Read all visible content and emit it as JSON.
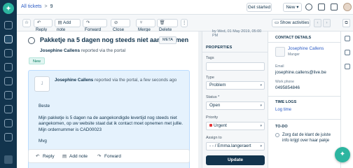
{
  "breadcrumb": {
    "link": "All tickets",
    "separator": ">",
    "ticket_id": "9"
  },
  "header": {
    "get_started": "Get started",
    "new_label": "New",
    "new_chevron": "▾"
  },
  "toolbar": {
    "star": "☆",
    "reply": "Reply",
    "add_note": "Add note",
    "forward": "Forward",
    "close": "Close",
    "merge": "Merge",
    "delete": "Delete",
    "more": "⋮",
    "show_activities": "Show activities",
    "prev": "‹",
    "next": "›",
    "expand": "⧉"
  },
  "ticket": {
    "subject": "Pakketje na 5 dagen nog steeds niet aangekomen",
    "meta_tag": "META",
    "reporter_name": "Josephine Callens",
    "reporter_text": "reported via the portal",
    "status_badge": "New"
  },
  "conversation": {
    "avatar_letter": "J",
    "author": "Josephine Callens",
    "header_text": "reported via the portal, a few seconds ago",
    "greeting": "Beste",
    "body": "Mijn pakketje is 5 dagen na de aangekondigde levertijd nog steeds niet aangekomen, op uw website staat dat ik contact moet opnemen met jullie.",
    "order": "Mijn ordernummer is CAD00023",
    "signoff": "Mvg"
  },
  "reply_bar": {
    "reply": "Reply",
    "add_note": "Add note",
    "forward": "Forward"
  },
  "properties": {
    "date": "by Wed, 01 May 2019, 05:00 PM",
    "heading": "PROPERTIES",
    "tags_label": "Tags",
    "type_label": "Type",
    "type_value": "Problem",
    "status_label": "Status *",
    "status_value": "Open",
    "priority_label": "Priority",
    "priority_value": "Urgent",
    "priority_color": "#e43538",
    "assign_label": "Assign to",
    "assign_value": "- - / Emma.langeraert",
    "update_button": "Update"
  },
  "contact": {
    "heading": "CONTACT DETAILS",
    "name": "Josephine Callens",
    "role": "Manger",
    "email_label": "Email",
    "email": "josephine.callens@live.be",
    "phone_label": "Work phone",
    "phone": "0495854846",
    "time_logs_heading": "TIME LOGS",
    "log_time": "Log time",
    "todo_heading": "TO-DO",
    "todo_item": "Zorg dat de klant de juiste info krijgt over haar pakje"
  },
  "colors": {
    "sidebar": "#12344d",
    "accent": "#2cb5a0",
    "link": "#2c5cc5",
    "conversation_bg": "#e5f2fd"
  }
}
